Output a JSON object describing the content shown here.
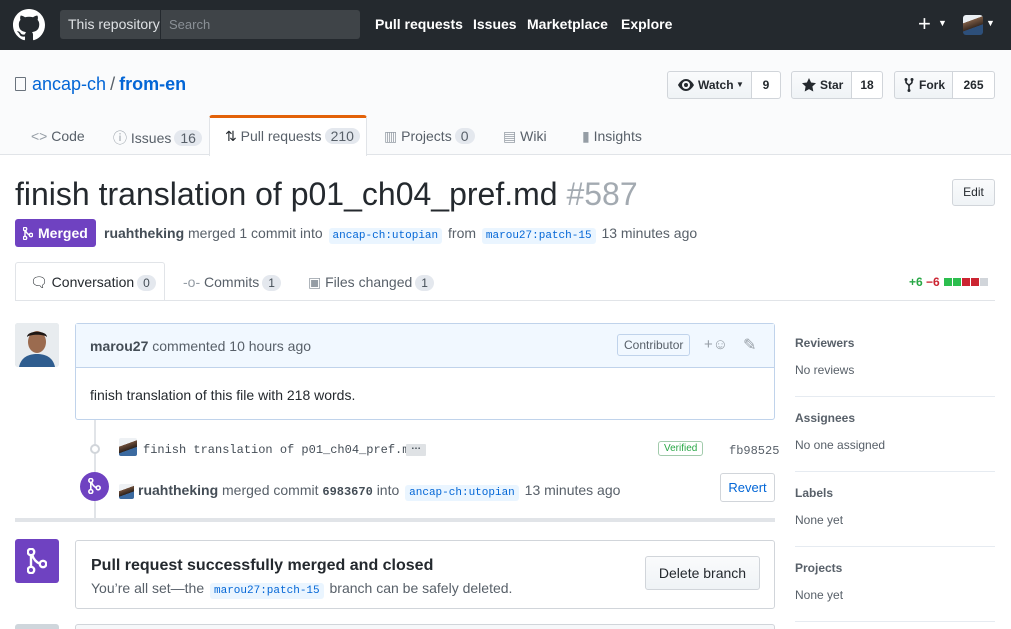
{
  "header": {
    "search_scope": "This repository",
    "search_placeholder": "Search",
    "nav": [
      "Pull requests",
      "Issues",
      "Marketplace",
      "Explore"
    ],
    "plus": "+"
  },
  "repo": {
    "owner": "ancap-ch",
    "separator": "/",
    "name": "from-en",
    "watch_label": "Watch",
    "watch_count": "9",
    "star_label": "Star",
    "star_count": "18",
    "fork_label": "Fork",
    "fork_count": "265",
    "tabs": {
      "code": "Code",
      "issues": "Issues",
      "issues_count": "16",
      "pulls": "Pull requests",
      "pulls_count": "210",
      "projects": "Projects",
      "projects_count": "0",
      "wiki": "Wiki",
      "insights": "Insights"
    }
  },
  "pr": {
    "title": "finish translation of p01_ch04_pref.md",
    "number": "#587",
    "edit": "Edit",
    "state": "Merged",
    "author": "ruahtheking",
    "action": "merged 1 commit into",
    "base": "ancap-ch:utopian",
    "from": "from",
    "head": "marou27:patch-15",
    "time": "13 minutes ago",
    "tabs": {
      "conversation": "Conversation",
      "conversation_count": "0",
      "commits": "Commits",
      "commits_count": "1",
      "files": "Files changed",
      "files_count": "1"
    },
    "diff_add": "+6",
    "diff_del": "−6"
  },
  "comment": {
    "author": "marou27",
    "when": "commented 10 hours ago",
    "badge": "Contributor",
    "body": "finish translation of this file with 218 words."
  },
  "commit": {
    "message": "finish translation of p01_ch04_pref.md",
    "ellipsis": "…",
    "verified": "Verified",
    "sha": "fb98525"
  },
  "merge_event": {
    "actor": "ruahtheking",
    "text1": "merged commit",
    "sha": "6983670",
    "text2": "into",
    "branch": "ancap-ch:utopian",
    "time": "13 minutes ago",
    "revert": "Revert"
  },
  "merged_box": {
    "title": "Pull request successfully merged and closed",
    "sub_pre": "You’re all set—the",
    "branch": "marou27:patch-15",
    "sub_post": "branch can be safely deleted.",
    "delete": "Delete branch"
  },
  "sidebar": [
    {
      "heading": "Reviewers",
      "value": "No reviews"
    },
    {
      "heading": "Assignees",
      "value": "No one assigned"
    },
    {
      "heading": "Labels",
      "value": "None yet"
    },
    {
      "heading": "Projects",
      "value": "None yet"
    }
  ],
  "colors": {
    "header_bg": "#24292e",
    "merged_purple": "#6f42c1",
    "link_blue": "#0366d6",
    "add_green": "#28a745",
    "del_red": "#cb2431",
    "tab_orange": "#e36209"
  }
}
